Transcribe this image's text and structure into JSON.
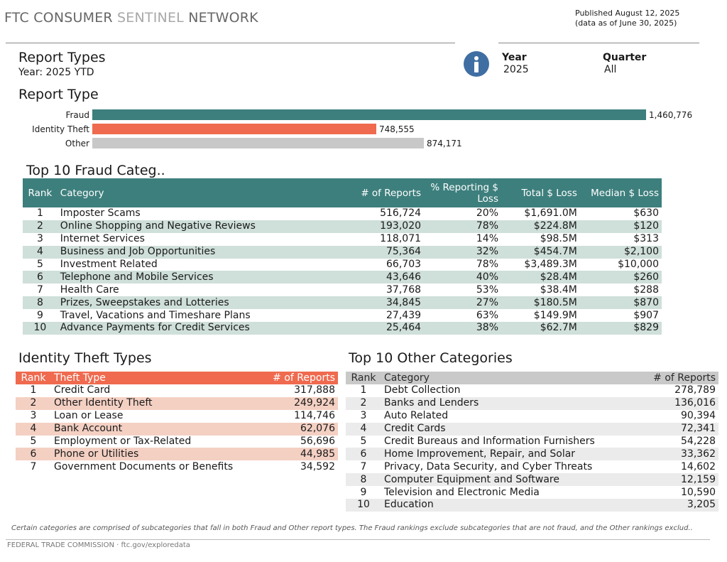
{
  "header": {
    "title_part1": "FTC CONSUMER",
    "title_part2": "SENTINEL",
    "title_part3": "NETWORK",
    "published": "Published August 12, 2025",
    "data_as_of": "(data as of June 30, 2025)"
  },
  "report": {
    "title": "Report Types",
    "subtitle": "Year: 2025 YTD",
    "info_icon": "info-icon"
  },
  "filters": {
    "year_label": "Year",
    "year_value": "2025",
    "quarter_label": "Quarter",
    "quarter_value": "All"
  },
  "report_type": {
    "title": "Report Type",
    "chart_data": {
      "type": "bar",
      "orientation": "horizontal",
      "categories": [
        "Fraud",
        "Identity Theft",
        "Other"
      ],
      "values": [
        1460776,
        748555,
        874171
      ],
      "value_labels": [
        "1,460,776",
        "748,555",
        "874,171"
      ],
      "colors": [
        "#3d7f7d",
        "#ef6a4f",
        "#c8c8c8"
      ]
    }
  },
  "fraud": {
    "title": "Top 10 Fraud Categ..",
    "headers": {
      "rank": "Rank",
      "category": "Category",
      "reports": "# of Reports",
      "pct": "% Reporting $ Loss",
      "total": "Total $ Loss",
      "median": "Median $ Loss"
    },
    "rows": [
      {
        "rank": "1",
        "category": "Imposter Scams",
        "reports": "516,724",
        "pct": "20%",
        "total": "$1,691.0M",
        "median": "$630"
      },
      {
        "rank": "2",
        "category": "Online Shopping and Negative Reviews",
        "reports": "193,020",
        "pct": "78%",
        "total": "$224.8M",
        "median": "$120"
      },
      {
        "rank": "3",
        "category": "Internet Services",
        "reports": "118,071",
        "pct": "14%",
        "total": "$98.5M",
        "median": "$313"
      },
      {
        "rank": "4",
        "category": "Business and Job Opportunities",
        "reports": "75,364",
        "pct": "32%",
        "total": "$454.7M",
        "median": "$2,100"
      },
      {
        "rank": "5",
        "category": "Investment Related",
        "reports": "66,703",
        "pct": "78%",
        "total": "$3,489.3M",
        "median": "$10,000"
      },
      {
        "rank": "6",
        "category": "Telephone and Mobile Services",
        "reports": "43,646",
        "pct": "40%",
        "total": "$28.4M",
        "median": "$260"
      },
      {
        "rank": "7",
        "category": "Health Care",
        "reports": "37,768",
        "pct": "53%",
        "total": "$38.4M",
        "median": "$288"
      },
      {
        "rank": "8",
        "category": "Prizes, Sweepstakes and Lotteries",
        "reports": "34,845",
        "pct": "27%",
        "total": "$180.5M",
        "median": "$870"
      },
      {
        "rank": "9",
        "category": "Travel, Vacations and Timeshare Plans",
        "reports": "27,439",
        "pct": "63%",
        "total": "$149.9M",
        "median": "$907"
      },
      {
        "rank": "10",
        "category": "Advance Payments for Credit Services",
        "reports": "25,464",
        "pct": "38%",
        "total": "$62.7M",
        "median": "$829"
      }
    ]
  },
  "identity": {
    "title": "Identity Theft Types",
    "headers": {
      "rank": "Rank",
      "type": "Theft Type",
      "reports": "# of Reports"
    },
    "rows": [
      {
        "rank": "1",
        "type": "Credit Card",
        "reports": "317,888"
      },
      {
        "rank": "2",
        "type": "Other Identity Theft",
        "reports": "249,924"
      },
      {
        "rank": "3",
        "type": "Loan or Lease",
        "reports": "114,746"
      },
      {
        "rank": "4",
        "type": "Bank Account",
        "reports": "62,076"
      },
      {
        "rank": "5",
        "type": "Employment or Tax-Related",
        "reports": "56,696"
      },
      {
        "rank": "6",
        "type": "Phone or Utilities",
        "reports": "44,985"
      },
      {
        "rank": "7",
        "type": "Government Documents or Benefits",
        "reports": "34,592"
      }
    ]
  },
  "other": {
    "title": "Top 10 Other Categories",
    "headers": {
      "rank": "Rank",
      "category": "Category",
      "reports": "# of Reports"
    },
    "rows": [
      {
        "rank": "1",
        "category": "Debt Collection",
        "reports": "278,789"
      },
      {
        "rank": "2",
        "category": "Banks and Lenders",
        "reports": "136,016"
      },
      {
        "rank": "3",
        "category": "Auto Related",
        "reports": "90,394"
      },
      {
        "rank": "4",
        "category": "Credit Cards",
        "reports": "72,341"
      },
      {
        "rank": "5",
        "category": "Credit Bureaus and Information Furnishers",
        "reports": "54,228"
      },
      {
        "rank": "6",
        "category": "Home Improvement, Repair, and Solar",
        "reports": "33,362"
      },
      {
        "rank": "7",
        "category": "Privacy, Data Security, and Cyber Threats",
        "reports": "14,602"
      },
      {
        "rank": "8",
        "category": "Computer Equipment and Software",
        "reports": "12,159"
      },
      {
        "rank": "9",
        "category": "Television and Electronic Media",
        "reports": "10,590"
      },
      {
        "rank": "10",
        "category": "Education",
        "reports": "3,205"
      }
    ]
  },
  "footnote": "Certain categories are comprised of subcategories that fall in both Fraud and Other report types. The Fraud rankings exclude subcategories that are not fraud, and the Other rankings exclud..",
  "footer": "FEDERAL TRADE COMMISSION · ftc.gov/exploredata"
}
